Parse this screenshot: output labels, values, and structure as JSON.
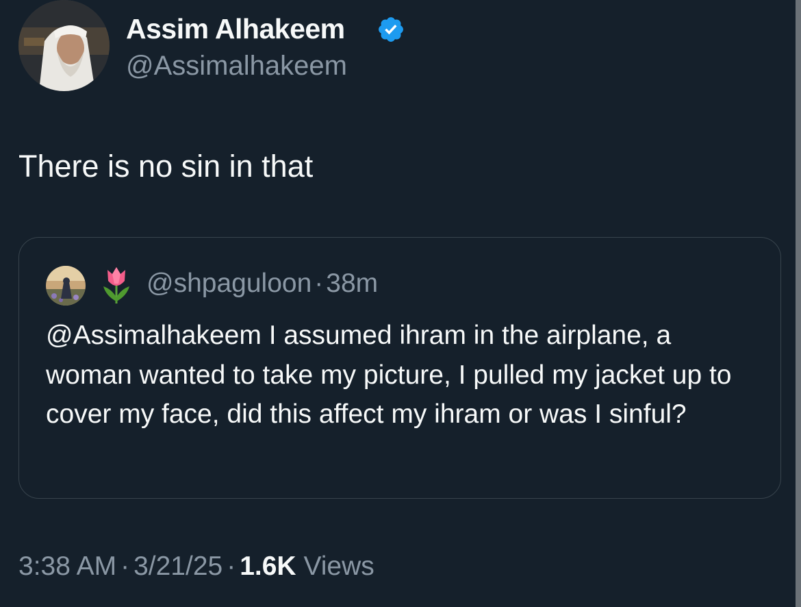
{
  "author": {
    "display_name": "Assim Alhakeem",
    "handle": "@Assimalhakeem",
    "verified_icon": "verified-badge-icon"
  },
  "tweet": {
    "text": "There is no sin in that"
  },
  "quote": {
    "emoji": "🌷",
    "handle": "@shpaguloon",
    "separator": "·",
    "time": "38m",
    "text": "@Assimalhakeem I assumed ihram in the airplane, a woman wanted to take my picture, I pulled my jacket up to cover my face, did this affect my ihram or was I sinful?"
  },
  "meta": {
    "time": "3:38 AM",
    "sep1": "·",
    "date": "3/21/25",
    "sep2": "·",
    "views_count": "1.6K",
    "views_label": "Views"
  },
  "colors": {
    "background": "#15202b",
    "text": "#f7f9f9",
    "secondary": "#8b98a5",
    "border": "#38444d",
    "verified": "#1d9bf0"
  }
}
